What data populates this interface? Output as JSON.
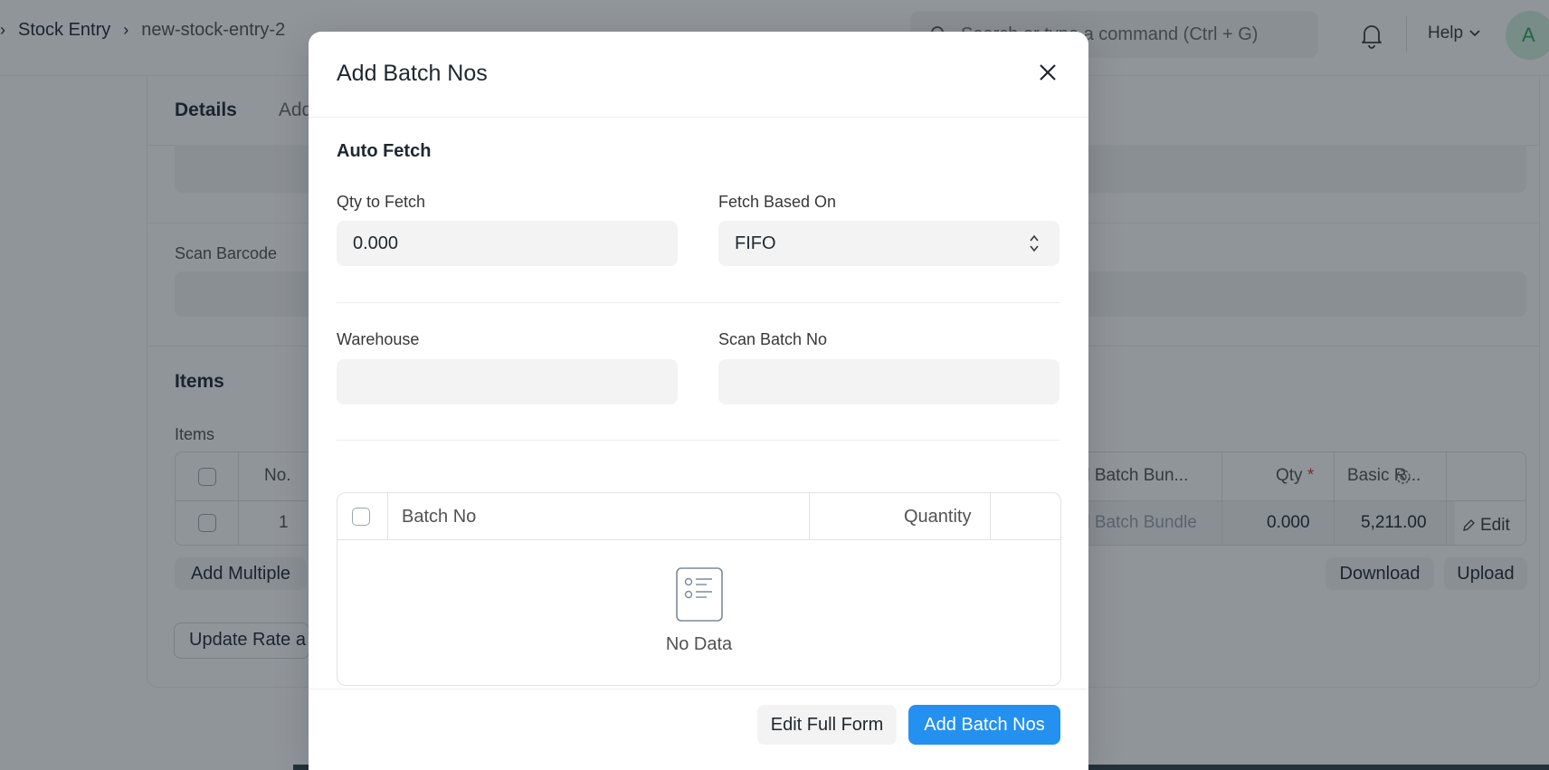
{
  "topbar": {
    "breadcrumbs": [
      "Stock Entry",
      "new-stock-entry-2"
    ],
    "search_placeholder": "Search or type a command (Ctrl + G)",
    "help_label": "Help",
    "avatar_initial": "A"
  },
  "page": {
    "tabs": [
      "Details",
      "Add"
    ],
    "scan_barcode_label": "Scan Barcode",
    "items_section_title": "Items",
    "items_table_label": "Items",
    "grid": {
      "headers": {
        "no": "No.",
        "bundle": "d Batch Bun...",
        "qty": "Qty",
        "qty_required": "*",
        "basic_rate": "Basic R..."
      },
      "row": {
        "no": "1",
        "bundle": "d Batch Bundle",
        "qty": "0.000",
        "basic_rate": "5,211.00",
        "edit": "Edit"
      }
    },
    "buttons": {
      "add_multiple": "Add Multiple",
      "download": "Download",
      "upload": "Upload",
      "update_rate": "Update Rate a"
    }
  },
  "modal": {
    "title": "Add Batch Nos",
    "section_title": "Auto Fetch",
    "qty_to_fetch": {
      "label": "Qty to Fetch",
      "value": "0.000"
    },
    "fetch_based_on": {
      "label": "Fetch Based On",
      "value": "FIFO"
    },
    "warehouse": {
      "label": "Warehouse",
      "value": ""
    },
    "scan_batch_no": {
      "label": "Scan Batch No",
      "value": ""
    },
    "table": {
      "headers": [
        "Batch No",
        "Quantity"
      ],
      "rows": [],
      "empty_text": "No Data"
    },
    "footer": {
      "secondary": "Edit Full Form",
      "primary": "Add Batch Nos"
    }
  },
  "colors": {
    "primary": "#2490ef",
    "required": "#e03636",
    "overlay": "rgba(22,33,43,0.48)"
  }
}
